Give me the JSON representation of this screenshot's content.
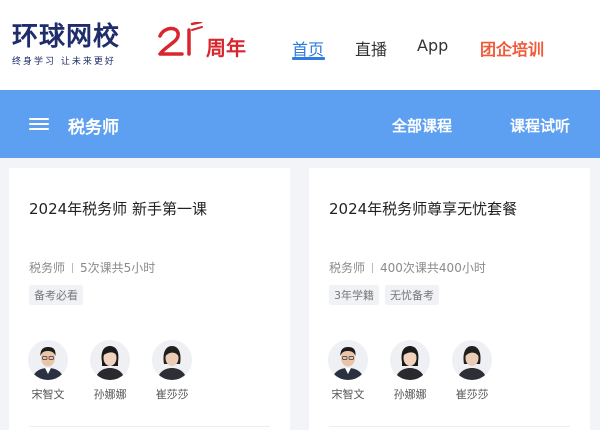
{
  "brand": {
    "name": "环球网校",
    "slogan": "终身学习 让未来更好",
    "anniversary_text": "周年"
  },
  "top_nav": [
    {
      "label": "首页",
      "active": true
    },
    {
      "label": "直播",
      "active": false
    },
    {
      "label": "App",
      "active": false
    },
    {
      "label": "团企培训",
      "active": false,
      "color": "#f05a3a"
    }
  ],
  "bar": {
    "title": "税务师",
    "links": [
      "全部课程",
      "课程试听"
    ],
    "color": "#5d9ff0"
  },
  "courses": [
    {
      "title": "2024年税务师 新手第一课",
      "subject": "税务师",
      "info": "5次课共5小时",
      "tags": [
        "备考必看"
      ],
      "teachers": [
        "宋智文",
        "孙娜娜",
        "崔莎莎"
      ]
    },
    {
      "title": "2024年税务师尊享无忧套餐",
      "subject": "税务师",
      "info": "400次课共400小时",
      "tags": [
        "3年学籍",
        "无忧备考"
      ],
      "teachers": [
        "宋智文",
        "孙娜娜",
        "崔莎莎"
      ]
    }
  ],
  "colors": {
    "accent": "#2f7be0",
    "brand_navy": "#1f2d6b",
    "anniversary_red": "#d8262e"
  }
}
